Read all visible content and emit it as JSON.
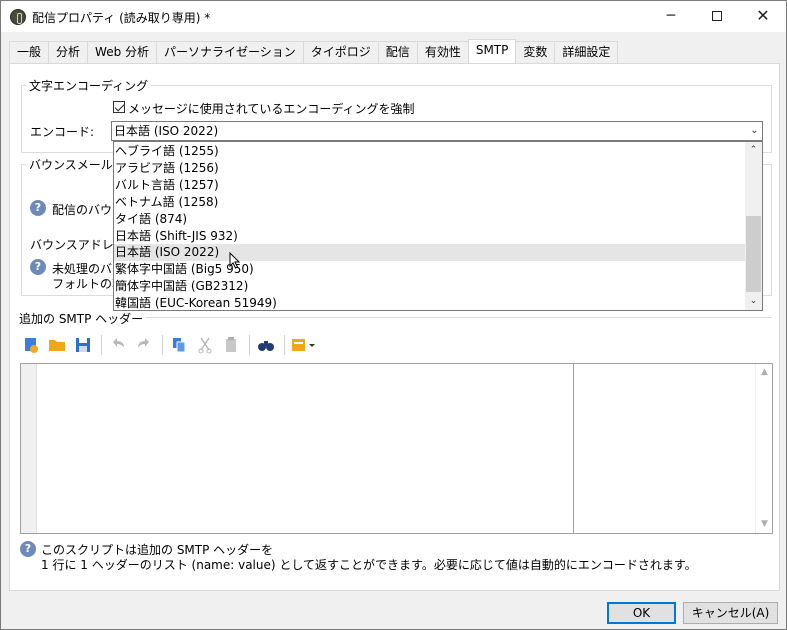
{
  "window": {
    "title": "配信プロパティ (読み取り専用) *",
    "min_glyph": "─",
    "close_glyph": "✕"
  },
  "tabs": [
    {
      "label": "一般"
    },
    {
      "label": "分析"
    },
    {
      "label": "Web 分析"
    },
    {
      "label": "パーソナライゼーション"
    },
    {
      "label": "タイポロジ"
    },
    {
      "label": "配信"
    },
    {
      "label": "有効性"
    },
    {
      "label": "SMTP"
    },
    {
      "label": "変数"
    },
    {
      "label": "詳細設定"
    }
  ],
  "active_tab": "SMTP",
  "encoding_group": {
    "title": "文字エンコーディング",
    "force_checkbox_label": "メッセージに使用されているエンコーディングを強制",
    "force_checked": true,
    "encode_label": "エンコード:",
    "encode_value": "日本語 (ISO 2022)"
  },
  "dropdown": {
    "items": [
      "ヘブライ語 (1255)",
      "アラビア語 (1256)",
      "バルト言語 (1257)",
      "ベトナム語 (1258)",
      "タイ語 (874)",
      "日本語 (Shift-JIS 932)",
      "日本語 (ISO 2022)",
      "繁体字中国語 (Big5 950)",
      "簡体字中国語 (GB2312)",
      "韓国語 (EUC-Korean 51949)"
    ],
    "hover_index": 6
  },
  "bounce_group": {
    "title": "バウンスメール",
    "help1_text": "配信のバウン",
    "address_label": "バウンスアドレス:",
    "help2_line1": "未処理のバウ",
    "help2_line2": "フォルトの転送"
  },
  "smtp_headers": {
    "title": "追加の SMTP ヘッダー",
    "help_line1": "このスクリプトは追加の SMTP ヘッダーを",
    "help_line2": "1 行に 1 ヘッダーのリスト (name: value) として返すことができます。必要に応じて値は自動的にエンコードされます。"
  },
  "toolbar_icons": [
    "new-script-icon",
    "open-folder-icon",
    "save-icon",
    "undo-icon",
    "redo-icon",
    "copy-icon",
    "cut-icon",
    "paste-icon",
    "find-icon",
    "insert-field-icon"
  ],
  "buttons": {
    "ok": "OK",
    "cancel": "キャンセル(A)"
  },
  "help_glyph": "?",
  "arrow_glyphs": {
    "down": "⌄",
    "up": "⌃",
    "scroll_up": "▲",
    "scroll_down": "▼"
  }
}
